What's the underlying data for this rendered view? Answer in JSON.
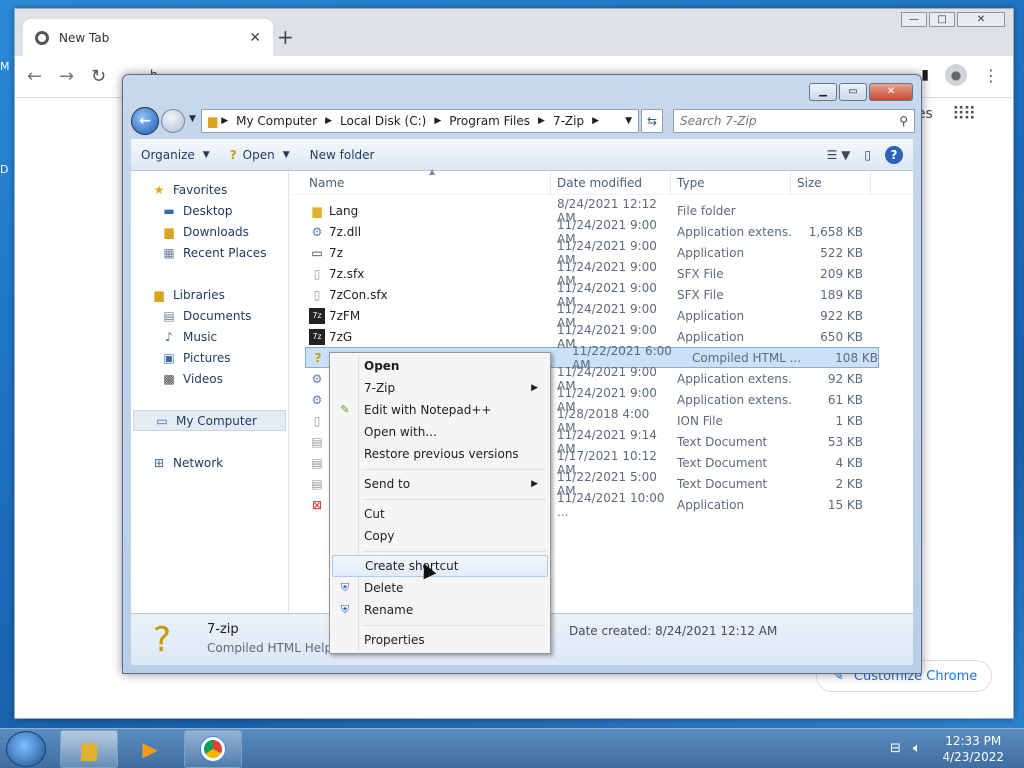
{
  "desktop": {
    "left_letters": [
      "M",
      "D"
    ]
  },
  "chrome": {
    "tab_title": "New Tab",
    "tab_close": "✕",
    "new_tab": "+",
    "omnibox_text": "h",
    "customize_label": "Customize Chrome",
    "apps_partial_text": "ges",
    "window_controls": {
      "minimize": "—",
      "maximize": "□",
      "close": "✕"
    }
  },
  "explorer": {
    "window_controls": {
      "minimize": "▁",
      "maximize": "▭",
      "close": "✕"
    },
    "breadcrumb": [
      "My Computer",
      "Local Disk (C:)",
      "Program Files",
      "7-Zip"
    ],
    "search_placeholder": "Search 7-Zip",
    "commands": {
      "organize": "Organize",
      "open": "Open",
      "new_folder": "New folder"
    },
    "nav": {
      "favorites": "Favorites",
      "favorites_items": [
        "Desktop",
        "Downloads",
        "Recent Places"
      ],
      "libraries": "Libraries",
      "libraries_items": [
        "Documents",
        "Music",
        "Pictures",
        "Videos"
      ],
      "my_computer": "My Computer",
      "network": "Network"
    },
    "columns": {
      "name": "Name",
      "date": "Date modified",
      "type": "Type",
      "size": "Size"
    },
    "files": [
      {
        "name": "Lang",
        "date": "8/24/2021 12:12 AM",
        "type": "File folder",
        "size": ""
      },
      {
        "name": "7z.dll",
        "date": "11/24/2021 9:00 AM",
        "type": "Application extens...",
        "size": "1,658 KB"
      },
      {
        "name": "7z",
        "date": "11/24/2021 9:00 AM",
        "type": "Application",
        "size": "522 KB"
      },
      {
        "name": "7z.sfx",
        "date": "11/24/2021 9:00 AM",
        "type": "SFX File",
        "size": "209 KB"
      },
      {
        "name": "7zCon.sfx",
        "date": "11/24/2021 9:00 AM",
        "type": "SFX File",
        "size": "189 KB"
      },
      {
        "name": "7zFM",
        "date": "11/24/2021 9:00 AM",
        "type": "Application",
        "size": "922 KB"
      },
      {
        "name": "7zG",
        "date": "11/24/2021 9:00 AM",
        "type": "Application",
        "size": "650 KB"
      },
      {
        "name": "",
        "date": "11/22/2021 6:00 AM",
        "type": "Compiled HTML ...",
        "size": "108 KB"
      },
      {
        "name": "",
        "date": "11/24/2021 9:00 AM",
        "type": "Application extens...",
        "size": "92 KB"
      },
      {
        "name": "",
        "date": "11/24/2021 9:00 AM",
        "type": "Application extens...",
        "size": "61 KB"
      },
      {
        "name": "",
        "date": "1/28/2018 4:00 AM",
        "type": "ION File",
        "size": "1 KB"
      },
      {
        "name": "",
        "date": "11/24/2021 9:14 AM",
        "type": "Text Document",
        "size": "53 KB"
      },
      {
        "name": "",
        "date": "1/17/2021 10:12 AM",
        "type": "Text Document",
        "size": "4 KB"
      },
      {
        "name": "",
        "date": "11/22/2021 5:00 AM",
        "type": "Text Document",
        "size": "2 KB"
      },
      {
        "name": "",
        "date": "11/24/2021 10:00 ...",
        "type": "Application",
        "size": "15 KB"
      }
    ],
    "details": {
      "name": "7-zip",
      "type": "Compiled HTML Help f",
      "created": "Date created: 8/24/2021 12:12 AM"
    }
  },
  "context_menu": {
    "open": "Open",
    "seven_zip": "7-Zip",
    "notepad": "Edit with Notepad++",
    "open_with": "Open with...",
    "restore": "Restore previous versions",
    "send_to": "Send to",
    "cut": "Cut",
    "copy": "Copy",
    "create_shortcut": "Create shortcut",
    "delete": "Delete",
    "rename": "Rename",
    "properties": "Properties"
  },
  "taskbar": {
    "time": "12:33 PM",
    "date": "4/23/2022"
  }
}
